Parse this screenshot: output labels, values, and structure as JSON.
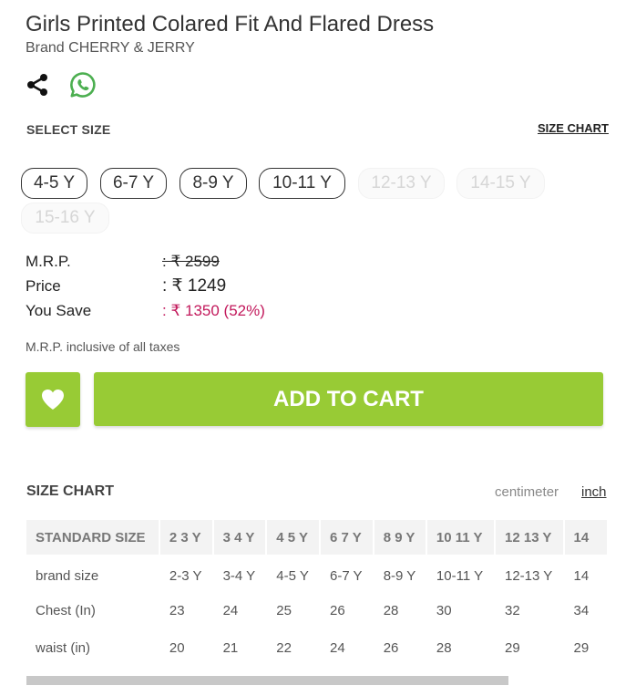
{
  "product": {
    "title": "Girls Printed Colared Fit And Flared Dress",
    "brand": "Brand CHERRY & JERRY"
  },
  "icons": {
    "share": "share-icon",
    "whatsapp": "whatsapp-icon",
    "wishlist": "heart-icon"
  },
  "size_select": {
    "label": "SELECT SIZE",
    "size_chart_link": "SIZE CHART",
    "sizes": [
      {
        "label": "4-5 Y",
        "available": true
      },
      {
        "label": "6-7 Y",
        "available": true
      },
      {
        "label": "8-9 Y",
        "available": true
      },
      {
        "label": "10-11 Y",
        "available": true
      },
      {
        "label": "12-13 Y",
        "available": false
      },
      {
        "label": "14-15 Y",
        "available": false
      },
      {
        "label": "15-16 Y",
        "available": false
      }
    ]
  },
  "pricing": {
    "mrp_label": "M.R.P.",
    "mrp_value": ": ₹ 2599",
    "price_label": "Price",
    "price_value": ": ₹ 1249",
    "save_label": "You Save",
    "save_value": ": ₹ 1350 (52%)",
    "tax_note": "M.R.P. inclusive of all taxes"
  },
  "actions": {
    "add_to_cart": "ADD TO CART"
  },
  "size_chart": {
    "title": "SIZE CHART",
    "unit_cm": "centimeter",
    "unit_inch": "inch",
    "headers": [
      "STANDARD SIZE",
      "2 3 Y",
      "3 4 Y",
      "4 5 Y",
      "6 7 Y",
      "8 9 Y",
      "10 11 Y",
      "12 13 Y",
      "14"
    ],
    "rows": [
      [
        "brand size",
        "2-3 Y",
        "3-4 Y",
        "4-5 Y",
        "6-7 Y",
        "8-9 Y",
        "10-11 Y",
        "12-13 Y",
        "14"
      ],
      [
        "Chest (In)",
        "23",
        "24",
        "25",
        "26",
        "28",
        "30",
        "32",
        "34"
      ],
      [
        "waist (in)",
        "20",
        "21",
        "22",
        "24",
        "26",
        "28",
        "29",
        "29"
      ]
    ]
  },
  "colors": {
    "accent": "#98cb35",
    "save": "#c2185b",
    "whatsapp": "#4caf50"
  }
}
